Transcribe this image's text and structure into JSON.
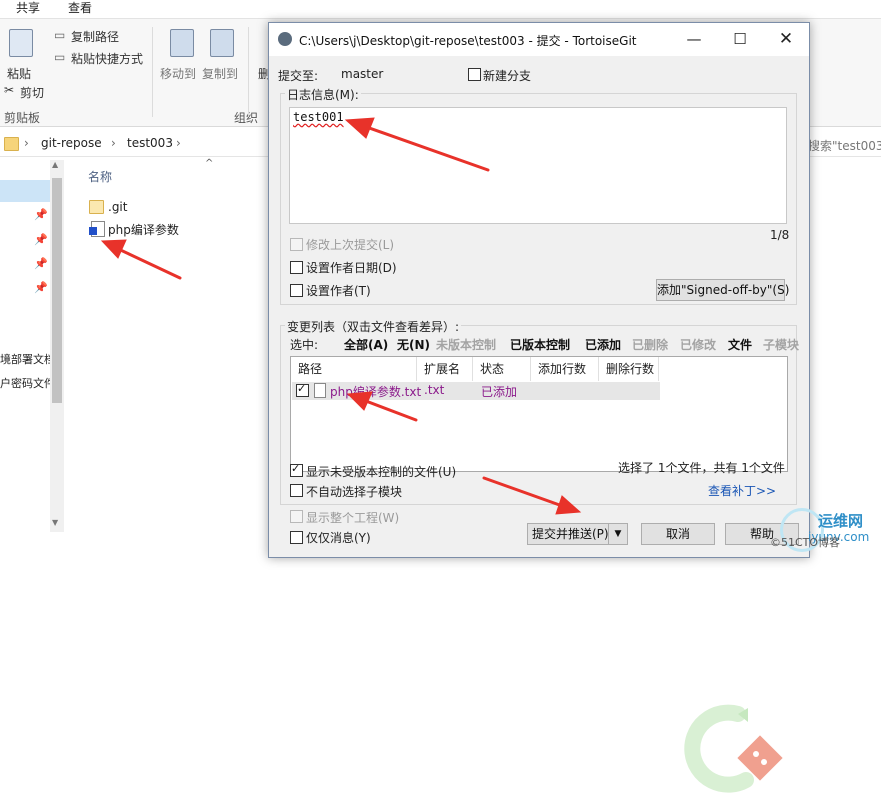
{
  "explorer": {
    "tabs": [
      "共享",
      "查看"
    ],
    "ribbon": {
      "paste": "粘贴",
      "cut": "剪切",
      "copy_path": "复制路径",
      "paste_shortcut": "粘贴快捷方式",
      "move_to": "移动到",
      "copy_to": "复制到",
      "delete_partial": "删",
      "clipboard_group": "剪贴板",
      "organize_group": "组织"
    },
    "breadcrumb": [
      "git-repose",
      "test003"
    ],
    "search_hint": "搜索\"test003\"",
    "column_name": "名称",
    "files": [
      ".git",
      "php编译参数"
    ],
    "nav_partial": [
      "境部署文档",
      "户密码文件"
    ]
  },
  "dialog": {
    "title": "C:\\Users\\j\\Desktop\\git-repose\\test003 - 提交 - TortoiseGit",
    "commit_to_label": "提交至:",
    "branch": "master",
    "new_branch": "新建分支",
    "message_label": "日志信息(M):",
    "message": "test001",
    "counter": "1/8",
    "amend": "修改上次提交(L)",
    "set_author_date": "设置作者日期(D)",
    "set_author": "设置作者(T)",
    "signed_off_button": "添加\"Signed-off-by\"(S)",
    "changes_label": "变更列表（双击文件查看差异）:",
    "select_label": "选中:",
    "filters": [
      {
        "label": "全部(A)",
        "enabled": true
      },
      {
        "label": "无(N)",
        "enabled": true
      },
      {
        "label": "未版本控制",
        "enabled": false
      },
      {
        "label": "已版本控制",
        "enabled": true
      },
      {
        "label": "已添加",
        "enabled": true
      },
      {
        "label": "已删除",
        "enabled": false
      },
      {
        "label": "已修改",
        "enabled": false
      },
      {
        "label": "文件",
        "enabled": true
      },
      {
        "label": "子模块",
        "enabled": false
      }
    ],
    "columns": [
      "路径",
      "扩展名",
      "状态",
      "添加行数",
      "删除行数"
    ],
    "rows": [
      {
        "path": "php编译参数.txt",
        "ext": ".txt",
        "status": "已添加",
        "added": "",
        "deleted": "",
        "checked": true
      }
    ],
    "show_unversioned": "显示未受版本控制的文件(U)",
    "no_auto_submodule": "不自动选择子模块",
    "selection_summary": "选择了 1个文件，共有 1个文件",
    "view_patch": "查看补丁>>",
    "show_whole_project": "显示整个工程(W)",
    "message_only": "仅仅消息(Y)",
    "commit_push_button": "提交并推送(P)",
    "cancel_button": "取消",
    "help_button": "帮助",
    "colors": {
      "status_added": "#8b1a8b",
      "arrow": "#e8322a",
      "link": "#1a56b5"
    }
  },
  "watermark": {
    "line1": "运维网",
    "line2": "iyunv.com",
    "line3": "©51CTO博客"
  }
}
